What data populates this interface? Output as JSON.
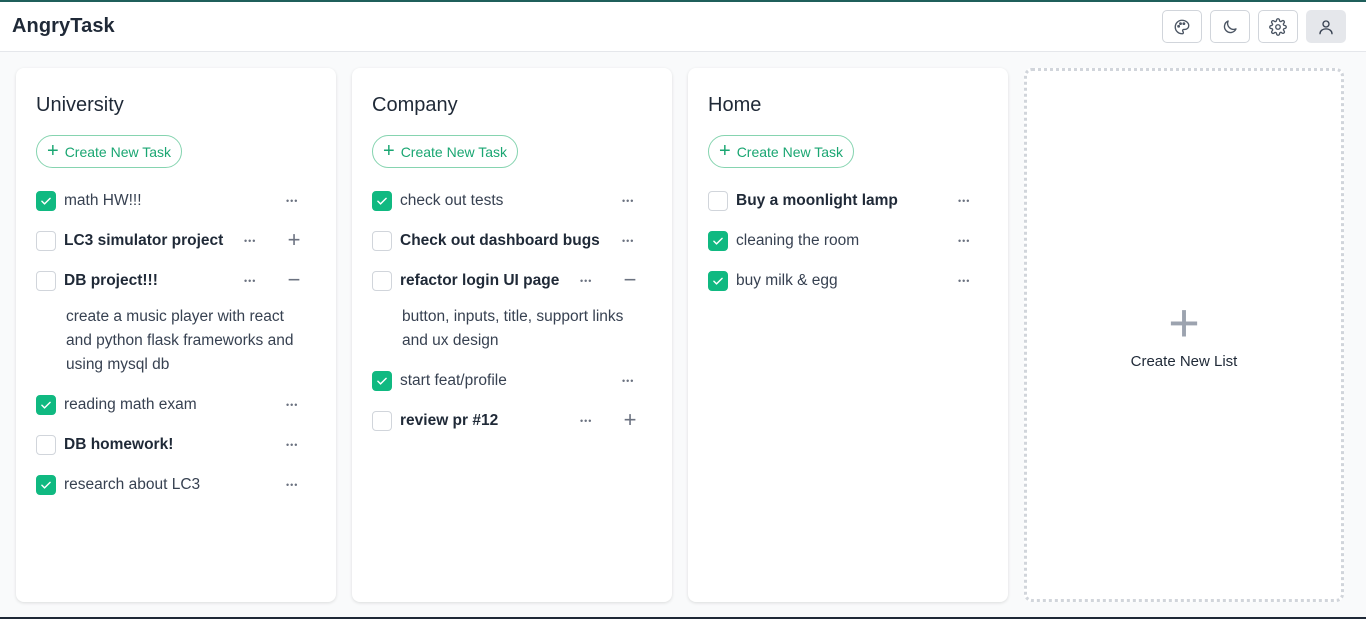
{
  "app": {
    "title": "AngryTask"
  },
  "header": {
    "buttons": [
      {
        "name": "palette-icon"
      },
      {
        "name": "moon-icon"
      },
      {
        "name": "gear-icon"
      },
      {
        "name": "user-icon"
      }
    ]
  },
  "colors": {
    "accent": "#10b981",
    "accent_text": "#1aa672",
    "border": "#d1d5db"
  },
  "create_task_label": "Create New Task",
  "create_list_label": "Create New List",
  "lists": [
    {
      "title": "University",
      "tasks": [
        {
          "title": "math HW!!!",
          "checked": true
        },
        {
          "title": "LC3 simulator project",
          "checked": false,
          "expand": "plus"
        },
        {
          "title": "DB project!!!",
          "checked": false,
          "expand": "minus",
          "description": "create a music player with react and python flask frameworks and using mysql db"
        },
        {
          "title": "reading math exam",
          "checked": true
        },
        {
          "title": "DB homework!",
          "checked": false
        },
        {
          "title": "research about LC3",
          "checked": true
        }
      ]
    },
    {
      "title": "Company",
      "tasks": [
        {
          "title": "check out tests",
          "checked": true
        },
        {
          "title": "Check out dashboard bugs",
          "checked": false
        },
        {
          "title": "refactor login UI page",
          "checked": false,
          "expand": "minus",
          "description": "button, inputs, title, support links and ux design"
        },
        {
          "title": "start feat/profile",
          "checked": true
        },
        {
          "title": "review pr #12",
          "checked": false,
          "expand": "plus"
        }
      ]
    },
    {
      "title": "Home",
      "tasks": [
        {
          "title": "Buy a moonlight lamp",
          "checked": false
        },
        {
          "title": "cleaning the room",
          "checked": true
        },
        {
          "title": "buy milk & egg",
          "checked": true
        }
      ]
    }
  ]
}
